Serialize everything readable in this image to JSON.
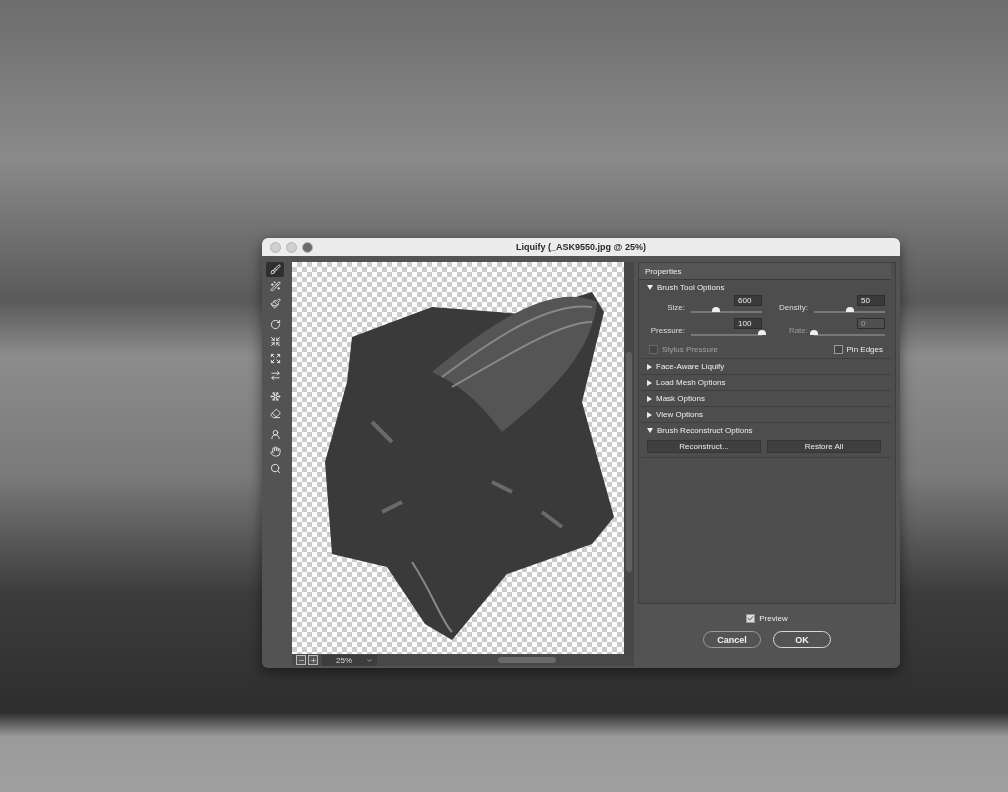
{
  "window": {
    "title": "Liquify (_ASK9550.jpg @ 25%)"
  },
  "tools": [
    {
      "kind": "warp",
      "selected": true
    },
    {
      "kind": "reconstruct",
      "selected": false
    },
    {
      "kind": "smooth",
      "selected": false
    },
    {
      "kind": "twirl",
      "selected": false
    },
    {
      "kind": "pucker",
      "selected": false
    },
    {
      "kind": "bloat",
      "selected": false
    },
    {
      "kind": "push",
      "selected": false
    },
    {
      "kind": "freeze",
      "selected": false
    },
    {
      "kind": "thaw",
      "selected": false
    },
    {
      "kind": "face",
      "selected": false
    },
    {
      "kind": "hand",
      "selected": false
    },
    {
      "kind": "zoom",
      "selected": false
    }
  ],
  "canvas": {
    "zoom": "25%"
  },
  "properties": {
    "title": "Properties",
    "sections": [
      {
        "kind": "brush",
        "title": "Brush Tool Options",
        "expanded": true
      },
      {
        "title": "Face-Aware Liquify",
        "expanded": false
      },
      {
        "title": "Load Mesh Options",
        "expanded": false
      },
      {
        "title": "Mask Options",
        "expanded": false
      },
      {
        "title": "View Options",
        "expanded": false
      },
      {
        "kind": "reconstruct",
        "title": "Brush Reconstruct Options",
        "expanded": true
      }
    ],
    "sliders": [
      {
        "label": "Size:",
        "value": "600",
        "level": 0.35,
        "disabled": false
      },
      {
        "label": "Density:",
        "value": "50",
        "level": 0.5,
        "disabled": false
      },
      {
        "label": "Pressure:",
        "value": "100",
        "level": 1,
        "disabled": false
      },
      {
        "label": "Rate:",
        "value": "0",
        "level": 0,
        "disabled": true
      }
    ],
    "checkboxes": [
      {
        "label": "Stylus Pressure",
        "checked": false,
        "disabled": true
      },
      {
        "label": "Pin Edges",
        "checked": false,
        "disabled": false
      }
    ],
    "reconstruct_buttons": [
      "Reconstruct...",
      "Restore All"
    ]
  },
  "preview": {
    "label": "Preview",
    "checked": true
  },
  "buttons": [
    "Cancel",
    "OK"
  ]
}
